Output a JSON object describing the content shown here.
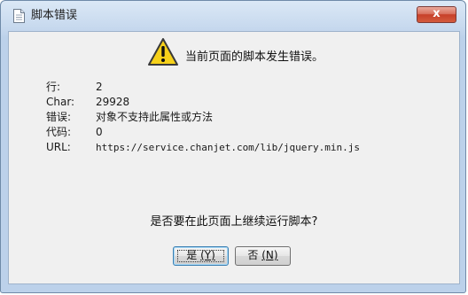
{
  "window": {
    "title": "脚本错误",
    "close_label": "x"
  },
  "icons": {
    "title": "document-icon",
    "warning": "warning-triangle-icon"
  },
  "message": {
    "headline": "当前页面的脚本发生错误。",
    "question": "是否要在此页面上继续运行脚本?"
  },
  "details": [
    {
      "label": "行:",
      "value": "2"
    },
    {
      "label": "Char:",
      "value": "29928"
    },
    {
      "label": "错误:",
      "value": "对象不支持此属性或方法"
    },
    {
      "label": "代码:",
      "value": "0"
    },
    {
      "label": "URL:",
      "value": "https://service.chanjet.com/lib/jquery.min.js"
    }
  ],
  "buttons": {
    "yes": {
      "text": "是",
      "accel": "(Y)"
    },
    "no": {
      "text": "否",
      "accel": "(N)"
    }
  },
  "colors": {
    "warning_fill": "#f6d11a",
    "close_red": "#c7402a",
    "dialog_bg": "#f0f0f0"
  }
}
